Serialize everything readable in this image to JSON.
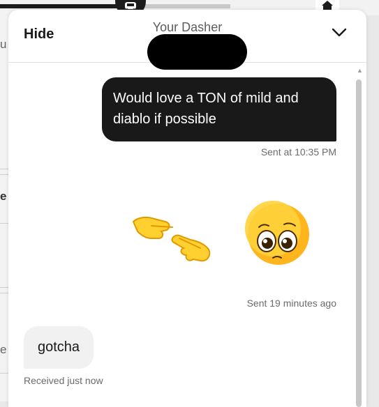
{
  "header": {
    "hide_label": "Hide",
    "title": "Your Dasher",
    "collapse_icon": "chevron-down-icon"
  },
  "messages": [
    {
      "direction": "outgoing",
      "text": "Would love a TON of mild and diablo if possible",
      "status": "Sent at 10:35 PM"
    },
    {
      "direction": "outgoing",
      "type": "emoji",
      "emoji": [
        "backhand-index-pointing-left",
        "backhand-index-pointing-right",
        "pleading-face"
      ],
      "status": "Sent 19 minutes ago"
    },
    {
      "direction": "incoming",
      "text": "gotcha",
      "status": "Received just now"
    }
  ],
  "colors": {
    "outgoing_bubble": "#191919",
    "incoming_bubble": "#f1f1f1",
    "meta_text": "#6b6b6b"
  }
}
